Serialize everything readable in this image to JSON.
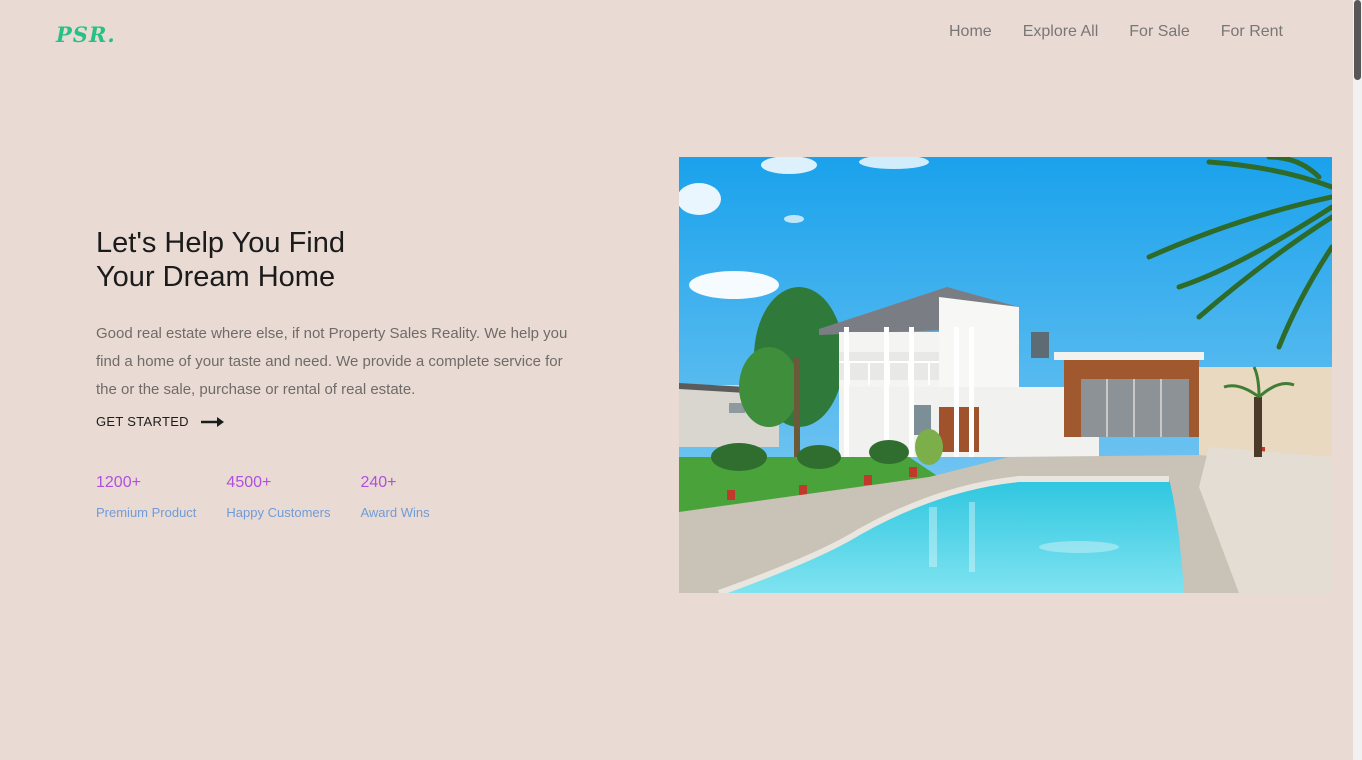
{
  "logo": "PSR.",
  "nav": [
    "Home",
    "Explore All",
    "For Sale",
    "For Rent"
  ],
  "hero": {
    "title_line1": "Let's Help You Find",
    "title_line2": "Your Dream Home",
    "description": "Good real estate where else, if not Property Sales Reality. We help you find a home of your taste and need. We provide a complete service for the or the sale, purchase or rental of real estate.",
    "cta_label": "GET STARTED",
    "cta_icon": "arrow-right-icon"
  },
  "stats": [
    {
      "value": "1200+",
      "label": "Premium Product"
    },
    {
      "value": "4500+",
      "label": "Happy Customers"
    },
    {
      "value": "240+",
      "label": "Award Wins"
    }
  ],
  "colors": {
    "background": "#e9dbd3",
    "logo": "#27c187",
    "stat_value": "#b04fe0",
    "stat_label": "#6f9bd8"
  }
}
